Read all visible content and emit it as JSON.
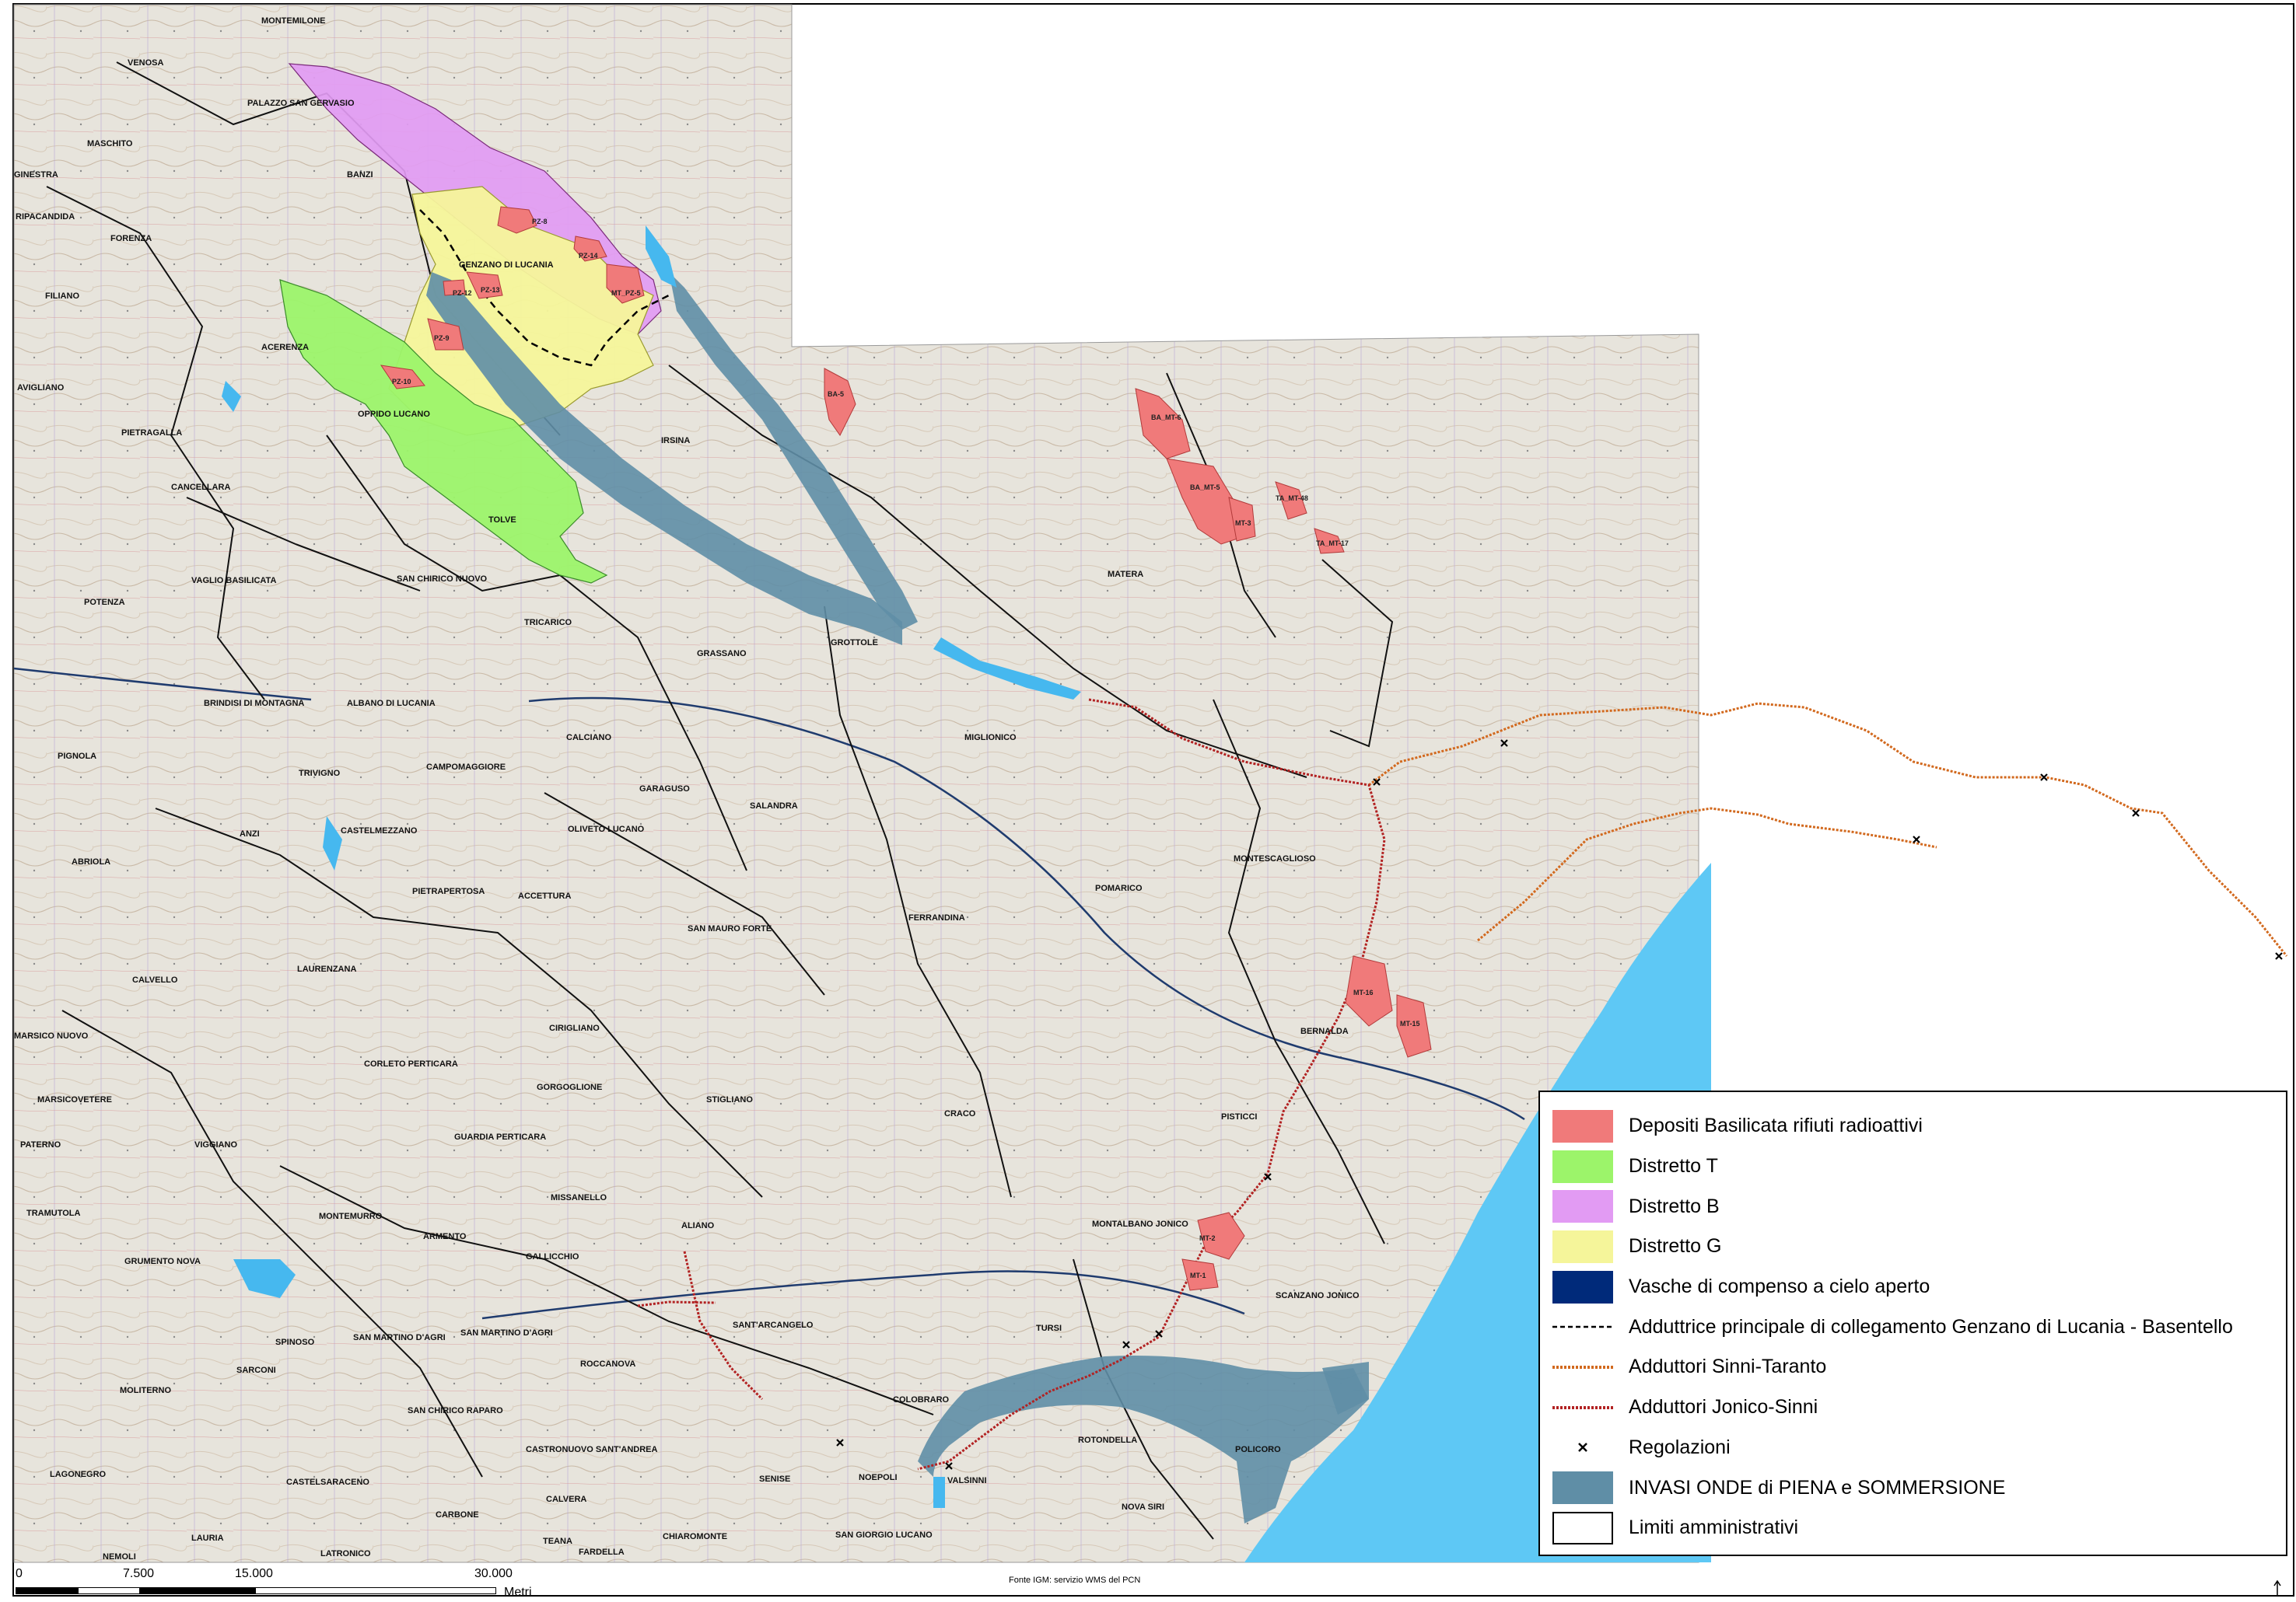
{
  "map": {
    "colors": {
      "background_map": "#e6e3db",
      "sea": "#5ec8f5",
      "deposits": "#f07a7a",
      "district_t": "#9cf46a",
      "district_b": "#e29bf3",
      "district_g": "#f5f59a",
      "flood": "#5f8ea6",
      "lake": "#46b8ef",
      "sinni_taranto": "#d2691e",
      "jonico_sinni": "#b22222"
    },
    "towns": [
      {
        "name": "MONTEMILONE"
      },
      {
        "name": "VENOSA"
      },
      {
        "name": "PALAZZO SAN GERVASIO"
      },
      {
        "name": "MASCHITO"
      },
      {
        "name": "GINESTRA"
      },
      {
        "name": "BANZI"
      },
      {
        "name": "RIPACANDIDA"
      },
      {
        "name": "FORENZA"
      },
      {
        "name": "GENZANO DI LUCANIA"
      },
      {
        "name": "FILIANO"
      },
      {
        "name": "ACERENZA"
      },
      {
        "name": "AVIGLIANO"
      },
      {
        "name": "PIETRAGALLA"
      },
      {
        "name": "OPPIDO LUCANO"
      },
      {
        "name": "IRSINA"
      },
      {
        "name": "CANCELLARA"
      },
      {
        "name": "TOLVE"
      },
      {
        "name": "VAGLIO BASILICATA"
      },
      {
        "name": "SAN CHIRICO NUOVO"
      },
      {
        "name": "POTENZA"
      },
      {
        "name": "TRICARICO"
      },
      {
        "name": "GRASSANO"
      },
      {
        "name": "GROTTOLE"
      },
      {
        "name": "MATERA"
      },
      {
        "name": "BRINDISI DI MONTAGNA"
      },
      {
        "name": "ALBANO DI LUCANIA"
      },
      {
        "name": "CALCIANO"
      },
      {
        "name": "MIGLIONICO"
      },
      {
        "name": "PIGNOLA"
      },
      {
        "name": "TRIVIGNO"
      },
      {
        "name": "CAMPOMAGGIORE"
      },
      {
        "name": "GARAGUSO"
      },
      {
        "name": "SALANDRA"
      },
      {
        "name": "ANZI"
      },
      {
        "name": "CASTELMEZZANO"
      },
      {
        "name": "OLIVETO LUCANO"
      },
      {
        "name": "ABRIOLA"
      },
      {
        "name": "MONTESCAGLIOSO"
      },
      {
        "name": "PIETRAPERTOSA"
      },
      {
        "name": "ACCETTURA"
      },
      {
        "name": "POMARICO"
      },
      {
        "name": "SAN MAURO FORTE"
      },
      {
        "name": "FERRANDINA"
      },
      {
        "name": "CALVELLO"
      },
      {
        "name": "LAURENZANA"
      },
      {
        "name": "BERNALDA"
      },
      {
        "name": "MARSICO NUOVO"
      },
      {
        "name": "CIRIGLIANO"
      },
      {
        "name": "CORLETO PERTICARA"
      },
      {
        "name": "GORGOGLIONE"
      },
      {
        "name": "MARSICOVETERE"
      },
      {
        "name": "STIGLIANO"
      },
      {
        "name": "CRACO"
      },
      {
        "name": "PISTICCI"
      },
      {
        "name": "PATERNO"
      },
      {
        "name": "VIGGIANO"
      },
      {
        "name": "GUARDIA PERTICARA"
      },
      {
        "name": "MISSANELLO"
      },
      {
        "name": "TRAMUTOLA"
      },
      {
        "name": "MONTEMURRO"
      },
      {
        "name": "MONTALBANO JONICO"
      },
      {
        "name": "ALIANO"
      },
      {
        "name": "ARMENTO"
      },
      {
        "name": "GALLICCHIO"
      },
      {
        "name": "GRUMENTO NOVA"
      },
      {
        "name": "SCANZANO JONICO"
      },
      {
        "name": "SPINOSO"
      },
      {
        "name": "SAN MARTINO D'AGRI"
      },
      {
        "name": "SAN MARTINO D'AGRI"
      },
      {
        "name": "SANT'ARCANGELO"
      },
      {
        "name": "TURSI"
      },
      {
        "name": "MOLITERNO"
      },
      {
        "name": "SARCONI"
      },
      {
        "name": "ROCCANOVA"
      },
      {
        "name": "COLOBRARO"
      },
      {
        "name": "SAN CHIRICO RAPARO"
      },
      {
        "name": "CASTRONUOVO SANT'ANDREA"
      },
      {
        "name": "ROTONDELLA"
      },
      {
        "name": "POLICORO"
      },
      {
        "name": "LAGONEGRO"
      },
      {
        "name": "CASTELSARACENO"
      },
      {
        "name": "SENISE"
      },
      {
        "name": "NOEPOLI"
      },
      {
        "name": "VALSINNI"
      },
      {
        "name": "CARBONE"
      },
      {
        "name": "CALVERA"
      },
      {
        "name": "NOVA SIRI"
      },
      {
        "name": "LAURIA"
      },
      {
        "name": "TEANA"
      },
      {
        "name": "CHIAROMONTE"
      },
      {
        "name": "SAN GIORGIO LUCANO"
      },
      {
        "name": "LATRONICO"
      },
      {
        "name": "FARDELLA"
      },
      {
        "name": "NEMOLI"
      }
    ],
    "deposit_labels": [
      {
        "label": "PZ-8"
      },
      {
        "label": "PZ-14"
      },
      {
        "label": "MT_PZ-5"
      },
      {
        "label": "PZ-13"
      },
      {
        "label": "PZ-12"
      },
      {
        "label": "PZ-9"
      },
      {
        "label": "PZ-10"
      },
      {
        "label": "BA-5"
      },
      {
        "label": "BA_MT-6"
      },
      {
        "label": "BA_MT-5"
      },
      {
        "label": "TA_MT-48"
      },
      {
        "label": "MT-3"
      },
      {
        "label": "TA_MT-17"
      },
      {
        "label": "MT-16"
      },
      {
        "label": "MT-15"
      },
      {
        "label": "MT-2"
      },
      {
        "label": "MT-1"
      }
    ]
  },
  "legend": {
    "items": [
      {
        "label": "Depositi Basilicata rifiuti radioattivi",
        "swatch": "fill",
        "color": "#f07a7a"
      },
      {
        "label": "Distretto T",
        "swatch": "fill",
        "color": "#9cf46a"
      },
      {
        "label": "Distretto B",
        "swatch": "fill",
        "color": "#e29bf3"
      },
      {
        "label": "Distretto G",
        "swatch": "fill",
        "color": "#f5f59a"
      },
      {
        "label": "Vasche di compenso a cielo aperto",
        "swatch": "fill",
        "color": "#002a7a"
      },
      {
        "label": "Adduttrice principale di collegamento Genzano di Lucania - Basentello",
        "swatch": "dashed",
        "color": "#000000"
      },
      {
        "label": "Adduttori Sinni-Taranto",
        "swatch": "line",
        "color": "#d2691e"
      },
      {
        "label": "Adduttori Jonico-Sinni",
        "swatch": "line",
        "color": "#b22222"
      },
      {
        "label": "Regolazioni",
        "swatch": "cross",
        "color": "#000000"
      },
      {
        "label": "INVASI ONDE di PIENA e SOMMERSIONE",
        "swatch": "fill",
        "color": "#5f8ea6"
      },
      {
        "label": "Limiti amministrativi",
        "swatch": "outline",
        "color": "#000000"
      }
    ]
  },
  "scalebar": {
    "ticks": [
      "0",
      "7.500",
      "15.000",
      "30.000"
    ],
    "unit": "Metri"
  },
  "source_note": "Fonte IGM: servizio WMS del PCN",
  "north_arrow": "N"
}
